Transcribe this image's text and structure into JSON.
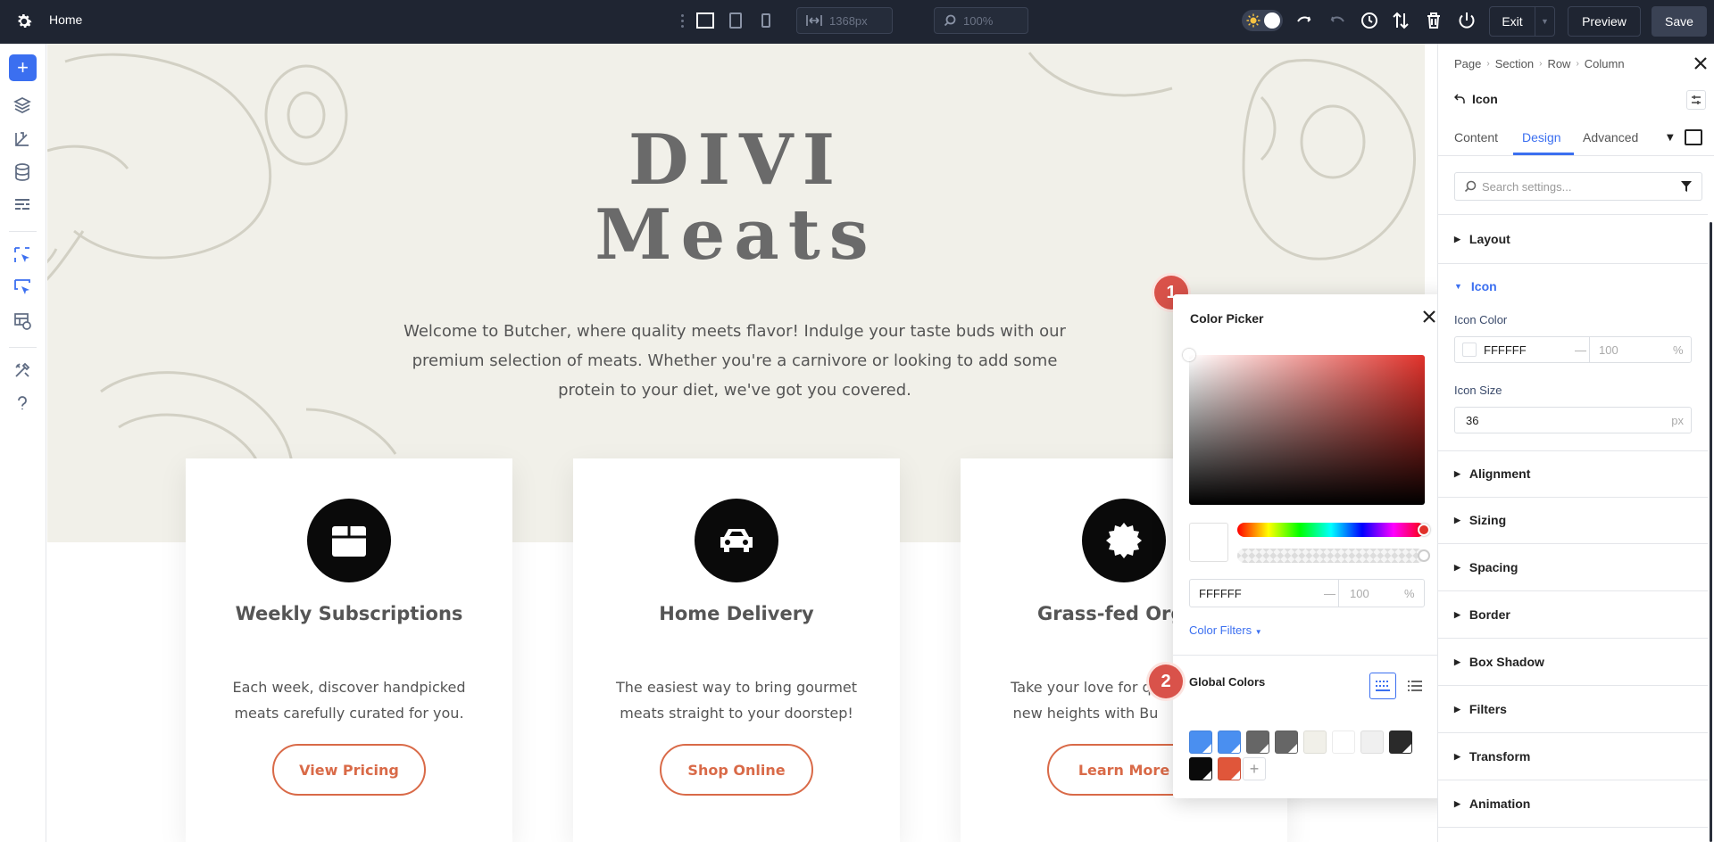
{
  "topbar": {
    "title": "Home",
    "width_value": "1368px",
    "zoom_value": "100%",
    "exit_label": "Exit",
    "preview_label": "Preview",
    "save_label": "Save"
  },
  "hero": {
    "brand_line1": "DIVI",
    "brand_line2": "Meats",
    "intro": "Welcome to Butcher, where quality meets flavor! Indulge your taste buds with our premium selection of meats. Whether you're a carnivore or looking to add some protein to your diet, we've got you covered."
  },
  "cards": [
    {
      "title": "Weekly Subscriptions",
      "desc": "Each week, discover handpicked meats carefully curated for you.",
      "button": "View Pricing",
      "icon": "box-icon"
    },
    {
      "title": "Home Delivery",
      "desc": "The easiest way to bring gourmet meats straight to your doorstep!",
      "button": "Shop Online",
      "icon": "car-icon"
    },
    {
      "title": "Grass-fed Org",
      "desc": "Take your love for qu new heights with Bu",
      "button": "Learn More",
      "icon": "badge-icon"
    }
  ],
  "badges": {
    "one": "1",
    "two": "2"
  },
  "color_picker": {
    "title": "Color Picker",
    "hex": "FFFFFF",
    "dash": "—",
    "opacity": "100",
    "percent": "%",
    "filters_label": "Color Filters",
    "global_title": "Global Colors",
    "add_label": "+",
    "swatches": [
      "#4a8ff0",
      "#4a8ff0",
      "#666666",
      "#666666",
      "#f1f0e9",
      "#ffffff",
      "#f0f0f0",
      "#2a2a2a",
      "#0a0a0a",
      "#e0563a"
    ]
  },
  "panel": {
    "breadcrumb": [
      "Page",
      "Section",
      "Row",
      "Column"
    ],
    "module_name": "Icon",
    "tabs": [
      "Content",
      "Design",
      "Advanced"
    ],
    "search_placeholder": "Search settings...",
    "groups": {
      "layout": "Layout",
      "icon": "Icon",
      "alignment": "Alignment",
      "sizing": "Sizing",
      "spacing": "Spacing",
      "border": "Border",
      "box_shadow": "Box Shadow",
      "filters": "Filters",
      "transform": "Transform",
      "animation": "Animation"
    },
    "icon_color_label": "Icon Color",
    "icon_color_hex": "FFFFFF",
    "icon_color_opacity": "100",
    "icon_color_dash": "—",
    "icon_color_percent": "%",
    "icon_size_label": "Icon Size",
    "icon_size_value": "36",
    "icon_size_unit": "px"
  },
  "colors": {
    "accent": "#3b6ff0",
    "button_outline": "#d96a48",
    "badge": "#d9524a",
    "topbar_bg": "#1f2532",
    "hero_bg": "#f1f0e9"
  }
}
